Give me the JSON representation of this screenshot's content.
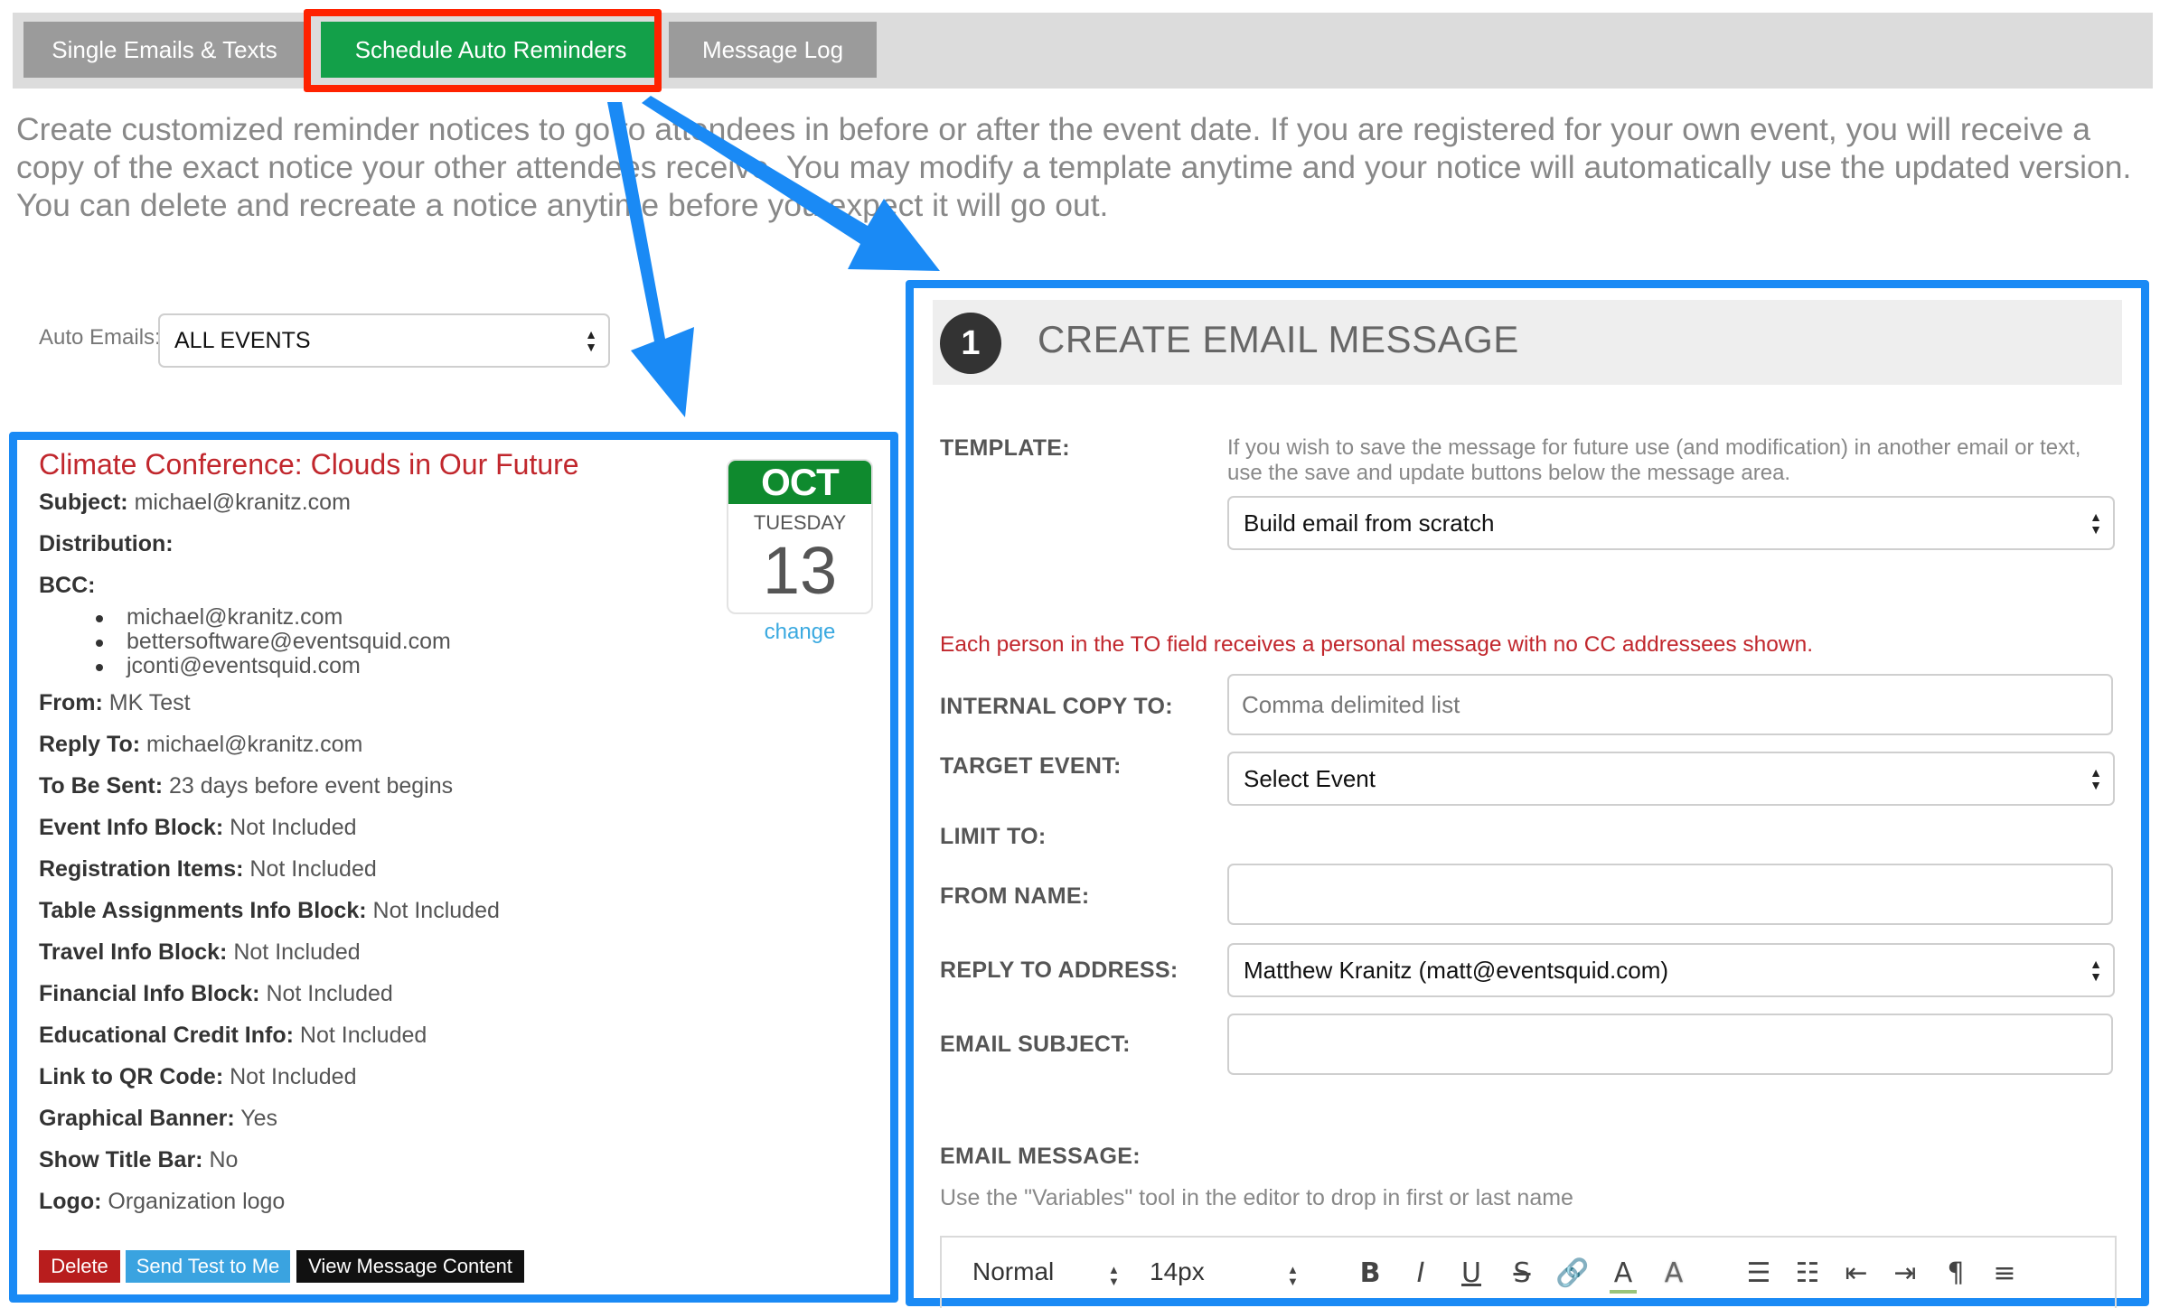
{
  "tabs": {
    "single": "Single Emails & Texts",
    "schedule": "Schedule Auto Reminders",
    "log": "Message Log"
  },
  "intro": "Create customized reminder notices to go to attendees in before or after the event date. If you are registered for your own event, you will receive a copy of the exact notice your other attendees receive. You may modify a template anytime and your notice will automatically use the updated version. You can delete and recreate a notice anytime before you expect it will go out.",
  "auto_emails": {
    "label": "Auto Emails:",
    "value": "ALL EVENTS"
  },
  "event": {
    "title": "Climate Conference: Clouds in Our Future",
    "subject_label": "Subject:",
    "subject": "michael@kranitz.com",
    "distribution_label": "Distribution:",
    "bcc_label": "BCC:",
    "bcc": [
      "michael@kranitz.com",
      "bettersoftware@eventsquid.com",
      "jconti@eventsquid.com"
    ],
    "from_label": "From:",
    "from": "MK Test",
    "reply_label": "Reply To:",
    "reply": "michael@kranitz.com",
    "sent_label": "To Be Sent:",
    "sent": "23 days before event begins",
    "eib_label": "Event Info Block:",
    "eib": "Not Included",
    "reg_label": "Registration Items:",
    "reg": "Not Included",
    "table_label": "Table Assignments Info Block:",
    "table": "Not Included",
    "travel_label": "Travel Info Block:",
    "travel": "Not Included",
    "fin_label": "Financial Info Block:",
    "fin": "Not Included",
    "edu_label": "Educational Credit Info:",
    "edu": "Not Included",
    "qr_label": "Link to QR Code:",
    "qr": "Not Included",
    "banner_label": "Graphical Banner:",
    "banner": "Yes",
    "titlebar_label": "Show Title Bar:",
    "titlebar": "No",
    "logo_label": "Logo:",
    "logo": "Organization logo",
    "calendar": {
      "month": "OCT",
      "weekday": "TUESDAY",
      "day": "13",
      "change": "change"
    },
    "buttons": {
      "delete": "Delete",
      "test": "Send Test to Me",
      "view": "View Message Content"
    }
  },
  "create": {
    "step": "1",
    "title": "CREATE EMAIL MESSAGE",
    "template_label": "TEMPLATE:",
    "template_help": "If you wish to save the message for future use (and modification) in another email or text, use the save and update buttons below the message area.",
    "template_value": "Build email from scratch",
    "notice": "Each person in the TO field receives a personal message with no CC addressees shown.",
    "internal_label": "INTERNAL COPY TO:",
    "internal_placeholder": "Comma delimited list",
    "target_label": "TARGET EVENT:",
    "target_value": "Select Event",
    "limit_label": "LIMIT TO:",
    "from_label": "FROM NAME:",
    "reply_label": "REPLY TO ADDRESS:",
    "reply_value": "Matthew Kranitz (matt@eventsquid.com)",
    "subject_label": "EMAIL SUBJECT:",
    "message_label": "EMAIL MESSAGE:",
    "message_hint": "Use the \"Variables\" tool in the editor to drop in first or last name",
    "toolbar": {
      "format": "Normal",
      "size": "14px"
    }
  },
  "colors": {
    "accent_blue": "#1a8af5",
    "active_tab": "#13a049",
    "highlight_red": "#ff2200",
    "event_title": "#c1272d"
  }
}
